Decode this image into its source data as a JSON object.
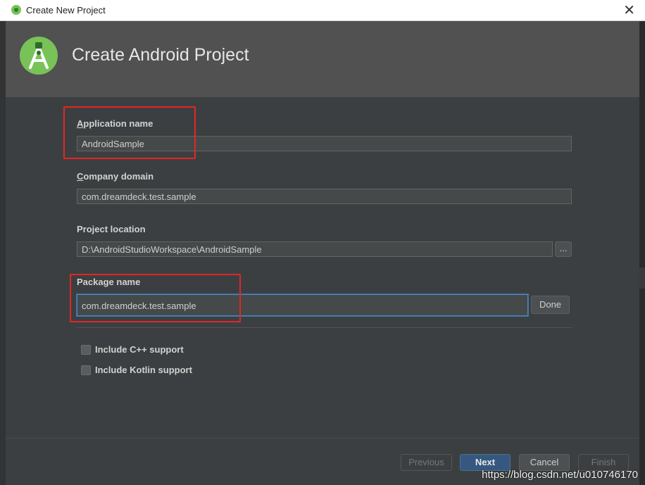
{
  "window": {
    "title": "Create New Project",
    "close_glyph": "✕"
  },
  "header": {
    "heading": "Create Android Project",
    "logo_icon": "android-studio-logo-icon"
  },
  "form": {
    "application_name": {
      "label_mnemonic": "A",
      "label_rest": "pplication name",
      "value": "AndroidSample"
    },
    "company_domain": {
      "label_mnemonic": "C",
      "label_rest": "ompany domain",
      "value": "com.dreamdeck.test.sample"
    },
    "project_location": {
      "label": "Project location",
      "value": "D:\\AndroidStudioWorkspace\\AndroidSample",
      "browse_label": "..."
    },
    "package_name": {
      "label": "Package name",
      "value": "com.dreamdeck.test.sample",
      "done_label": "Done"
    }
  },
  "options": [
    {
      "label": "Include C++ support",
      "checked": false
    },
    {
      "label": "Include Kotlin support",
      "checked": false
    }
  ],
  "footer": {
    "previous": "Previous",
    "next": "Next",
    "cancel": "Cancel",
    "finish": "Finish"
  },
  "watermark": "https://blog.csdn.net/u010746170",
  "colors": {
    "annotation_red": "#e32626",
    "dialog_bg": "#3c3f41",
    "header_bg": "#515151",
    "focus_blue": "#4a88c7"
  }
}
